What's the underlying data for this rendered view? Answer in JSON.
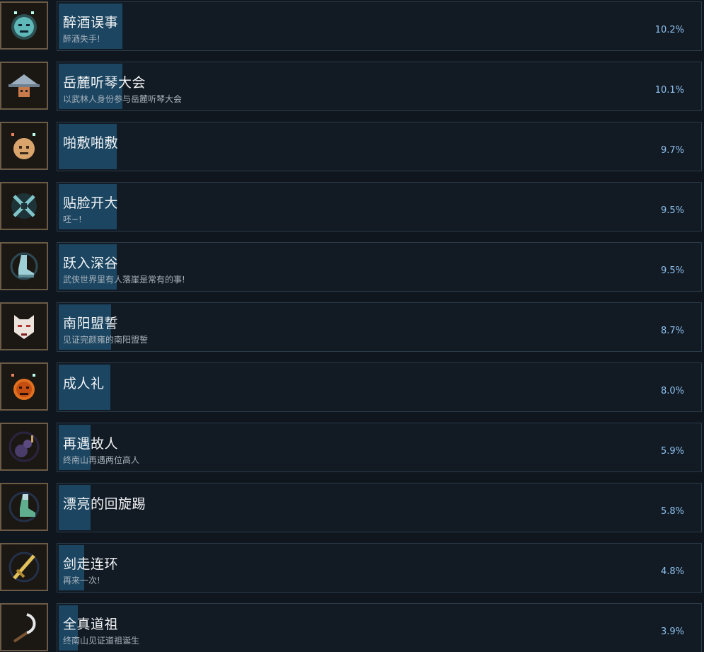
{
  "achievements": [
    {
      "title": "醉酒误事",
      "desc": "醉酒失手!",
      "percent": "10.2%",
      "progress": 0.102,
      "icon": "drunk-face-icon"
    },
    {
      "title": "岳麓听琴大会",
      "desc": "以武林人身份参与岳麓听琴大会",
      "percent": "10.1%",
      "progress": 0.101,
      "icon": "straw-hat-icon"
    },
    {
      "title": "啪敷啪敷",
      "desc": "",
      "percent": "9.7%",
      "progress": 0.097,
      "icon": "smiling-face-icon"
    },
    {
      "title": "贴脸开大",
      "desc": "呸~!",
      "percent": "9.5%",
      "progress": 0.095,
      "icon": "crossed-arrows-icon"
    },
    {
      "title": "跃入深谷",
      "desc": "武侠世界里有人落崖是常有的事!",
      "percent": "9.5%",
      "progress": 0.095,
      "icon": "boot-icon"
    },
    {
      "title": "南阳盟誓",
      "desc": "见证完颜雍的南阳盟誓",
      "percent": "8.7%",
      "progress": 0.087,
      "icon": "mask-icon"
    },
    {
      "title": "成人礼",
      "desc": "",
      "percent": "8.0%",
      "progress": 0.08,
      "icon": "angry-face-icon"
    },
    {
      "title": "再遇故人",
      "desc": "终南山再遇两位高人",
      "percent": "5.9%",
      "progress": 0.059,
      "icon": "gourd-icon"
    },
    {
      "title": "漂亮的回旋踢",
      "desc": "",
      "percent": "5.8%",
      "progress": 0.058,
      "icon": "kick-boot-icon"
    },
    {
      "title": "剑走连环",
      "desc": "再来一次!",
      "percent": "4.8%",
      "progress": 0.048,
      "icon": "sword-icon"
    },
    {
      "title": "全真道祖",
      "desc": "终南山见证道祖诞生",
      "percent": "3.9%",
      "progress": 0.039,
      "icon": "whisk-icon"
    }
  ]
}
